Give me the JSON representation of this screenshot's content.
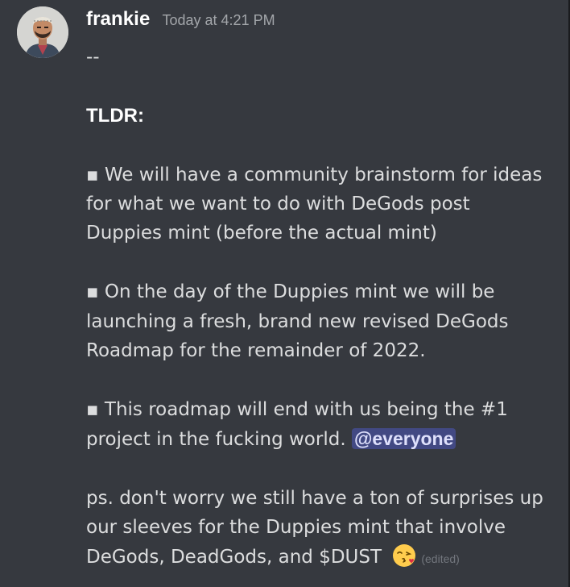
{
  "author": {
    "name": "frankie",
    "timestamp": "Today at 4:21 PM",
    "avatar_icon": "avatar-portrait-icon"
  },
  "message": {
    "line_dashes": "--",
    "tldr": "TLDR:",
    "bullet1_line1": "▪ We will have a community brainstorm for ideas",
    "bullet1_line2": "for what we want to do with DeGods post",
    "bullet1_line3": "Duppies mint (before the actual mint)",
    "bullet2_line1": "▪ On the day of the Duppies mint we will be",
    "bullet2_line2": "launching a fresh, brand new revised DeGods",
    "bullet2_line3": "Roadmap for the remainder of 2022.",
    "bullet3_line1": "▪ This roadmap will end with us being the #1",
    "bullet3_line2": "project in the fucking world. ",
    "mention": "@everyone",
    "ps_line1": "ps. don't worry we still have a ton of surprises up",
    "ps_line2": "our sleeves for the Duppies mint that involve",
    "ps_line3": "DeGods, DeadGods, and $DUST ",
    "emoji_icon": "face-blowing-kiss-emoji-icon",
    "edited": "(edited)"
  },
  "colors": {
    "background": "#36393f",
    "username": "#ffffff",
    "timestamp": "#a3a6aa",
    "text": "#dcddde",
    "mention_bg": "rgba(88,101,242,0.38)",
    "mention_text": "#dee0fc",
    "edited": "#72767d"
  }
}
